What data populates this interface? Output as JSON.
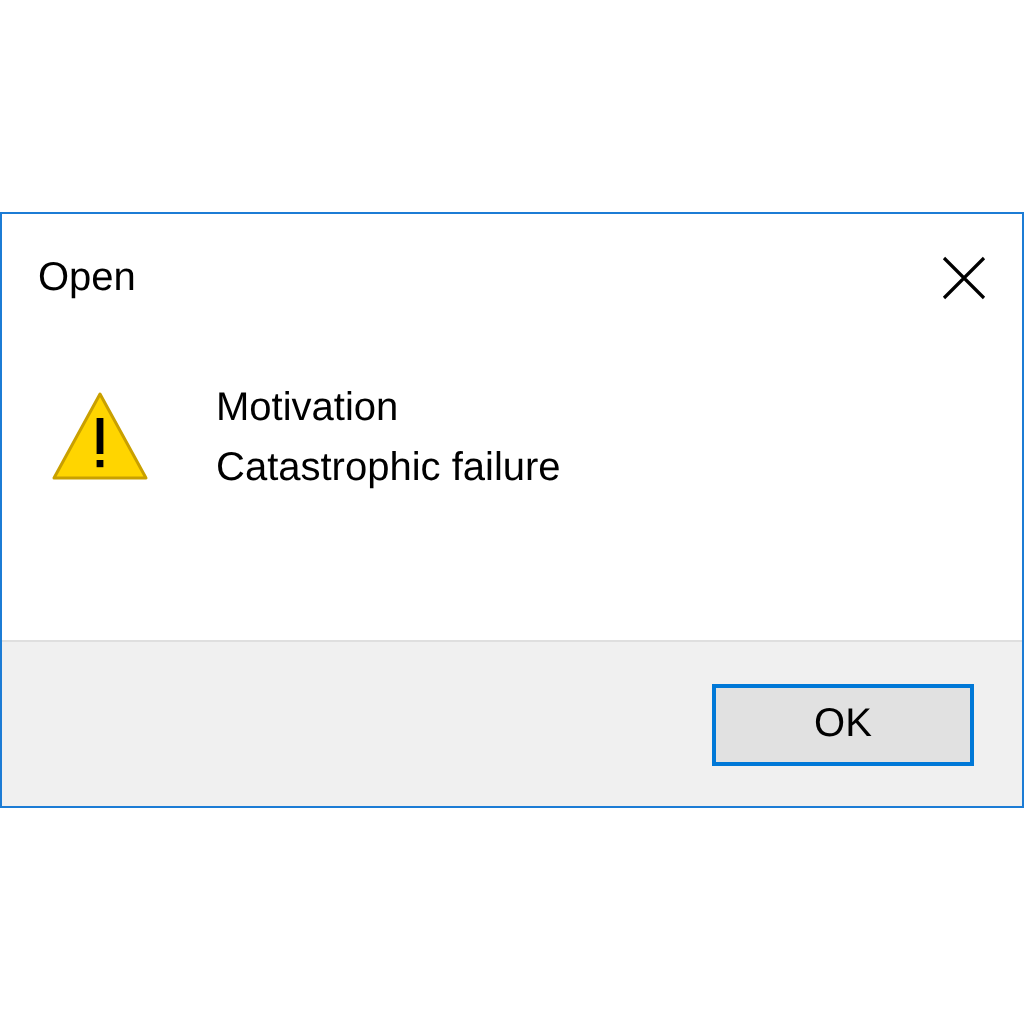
{
  "window": {
    "title": "Open"
  },
  "message": {
    "lines": [
      "Motivation",
      "Catastrophic failure"
    ]
  },
  "buttons": [
    "OK"
  ]
}
